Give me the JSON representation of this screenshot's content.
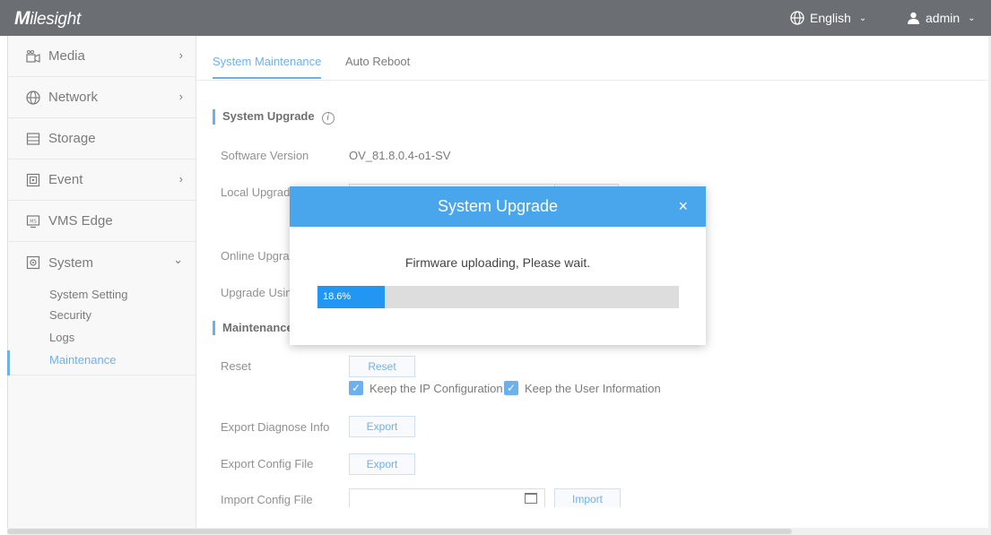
{
  "app": {
    "logo": "Milesight",
    "language": "English",
    "user": "admin"
  },
  "sidebar": {
    "items": [
      {
        "label": "Media",
        "icon": "media-icon",
        "has_arrow": true
      },
      {
        "label": "Network",
        "icon": "globe-icon",
        "has_arrow": true
      },
      {
        "label": "Storage",
        "icon": "storage-icon",
        "has_arrow": false
      },
      {
        "label": "Event",
        "icon": "event-icon",
        "has_arrow": true
      },
      {
        "label": "VMS Edge",
        "icon": "vms-edge-icon",
        "has_arrow": false
      },
      {
        "label": "System",
        "icon": "system-icon",
        "expanded": true
      }
    ],
    "system_sub": [
      "System Setting",
      "Security",
      "Logs",
      "Maintenance"
    ],
    "active_sub": "Maintenance"
  },
  "tabs": [
    "System Maintenance",
    "Auto Reboot"
  ],
  "active_tab": "System Maintenance",
  "upgrade": {
    "title": "System Upgrade",
    "software_version_label": "Software Version",
    "software_version": "OV_81.8.0.4-o1-SV",
    "local_upgrade_label": "Local Upgrade",
    "online_upgrade_label": "Online Upgrade",
    "upgrade_using_label": "Upgrade Using"
  },
  "maintenance": {
    "title": "Maintenance",
    "reset_label": "Reset",
    "reset_button": "Reset",
    "keep_ip": "Keep the IP Configuration",
    "keep_user": "Keep the User Information",
    "export_diagnose_label": "Export Diagnose Info",
    "export_button": "Export",
    "export_config_label": "Export Config File",
    "import_config_label": "Import Config File",
    "import_button": "Import"
  },
  "modal": {
    "title": "System Upgrade",
    "message": "Firmware uploading, Please wait.",
    "progress_text": "18.6%",
    "progress_value": 18.6,
    "close": "×"
  },
  "colors": {
    "accent": "#1e88e5",
    "topbar": "#1d2128",
    "modal_header": "#4aa6ec"
  }
}
